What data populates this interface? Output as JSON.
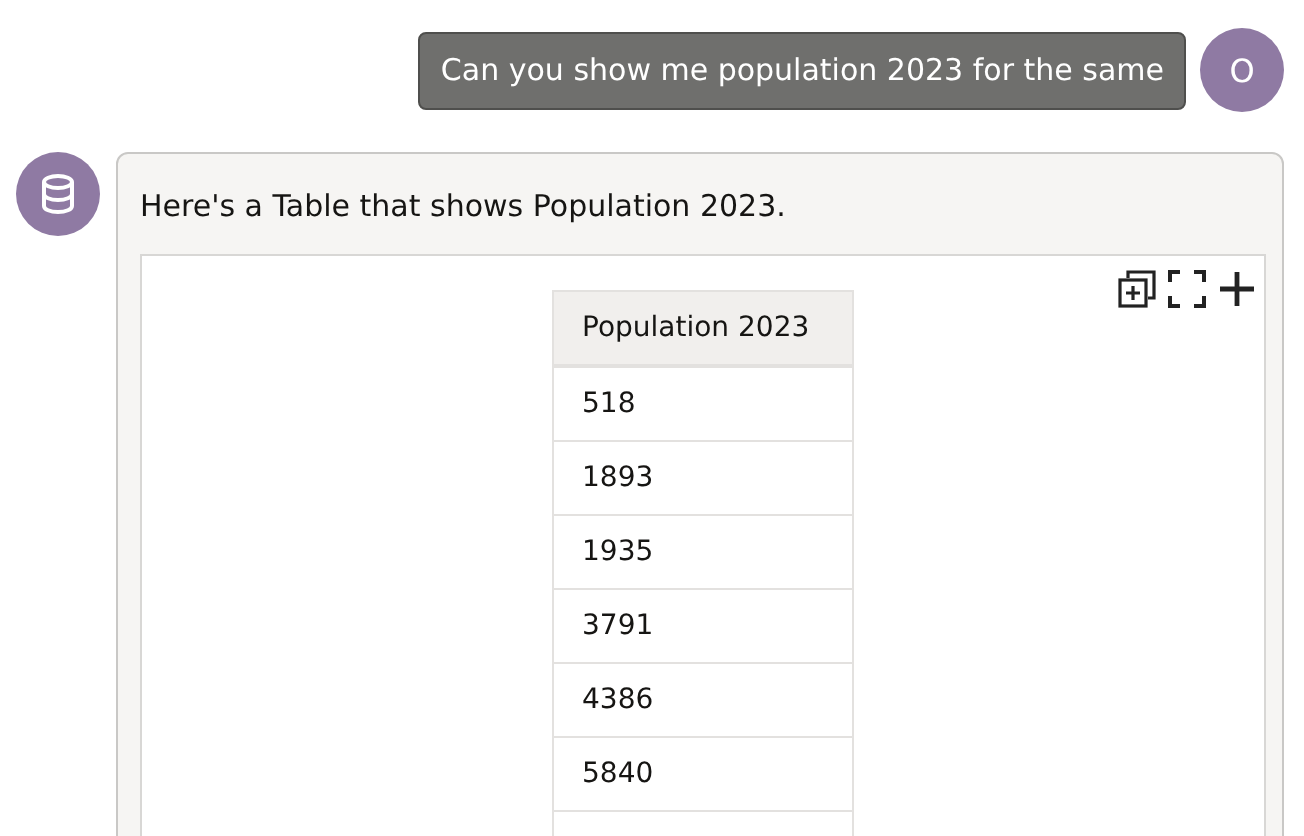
{
  "user_message": {
    "text": "Can you show me population 2023 for the same",
    "avatar_letter": "O"
  },
  "reply": {
    "text": "Here's a Table that shows Population 2023.",
    "table": {
      "columns": [
        "Population 2023"
      ],
      "rows": [
        [
          "518"
        ],
        [
          "1893"
        ],
        [
          "1935"
        ],
        [
          "3791"
        ],
        [
          "4386"
        ],
        [
          "5840"
        ]
      ]
    }
  }
}
